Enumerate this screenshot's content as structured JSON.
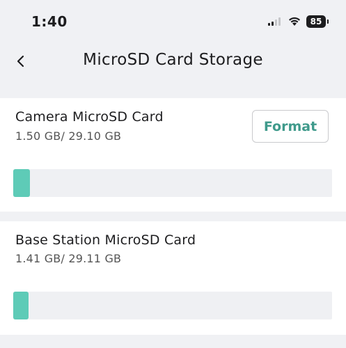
{
  "status_bar": {
    "time": "1:40",
    "battery": "85",
    "signal_icon": "cellular-signal-icon",
    "wifi_icon": "wifi-icon"
  },
  "nav": {
    "title": "MicroSD Card Storage",
    "back_icon": "chevron-left-icon"
  },
  "cards": [
    {
      "title": "Camera MicroSD Card",
      "usage": "1.50 GB/ 29.10 GB",
      "used_gb": 1.5,
      "total_gb": 29.1,
      "format_label": "Format"
    },
    {
      "title": "Base Station MicroSD Card",
      "usage": "1.41 GB/ 29.11 GB",
      "used_gb": 1.41,
      "total_gb": 29.11
    }
  ],
  "colors": {
    "accent": "#3f9a8b",
    "bar_fill": "#5ecbb7",
    "bar_track": "#eff0f3",
    "background": "#f0f1f4"
  }
}
